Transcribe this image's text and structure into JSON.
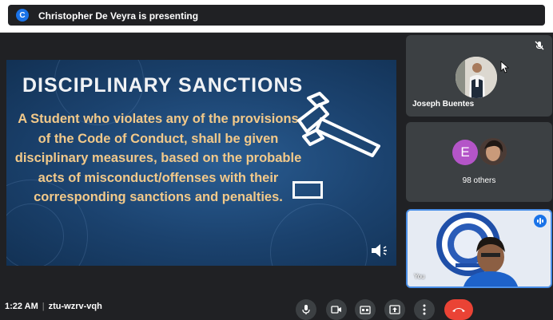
{
  "presenter": {
    "initial": "C",
    "banner": "Christopher De Veyra is presenting"
  },
  "slide": {
    "title": "DISCIPLINARY SANCTIONS",
    "body": "A Student who violates any of the provisions of the Code of Conduct, shall be given disciplinary measures, based on the probable acts of misconduct/offenses with their corresponding sanctions and penalties."
  },
  "participants": {
    "tile1": {
      "name": "Joseph Buentes",
      "muted": true
    },
    "tile2": {
      "avatar_initial": "E",
      "count_label": "98 others"
    },
    "tile3": {
      "label": "You",
      "speaking": true
    }
  },
  "bottombar": {
    "time": "1:22 AM",
    "meeting_code": "ztu-wzrv-vqh"
  },
  "icons": {
    "controls": [
      "mic-icon",
      "camera-icon",
      "captions-icon",
      "present-icon",
      "more-icon",
      "end-call-icon"
    ]
  },
  "colors": {
    "accent": "#1a73e8",
    "end_call": "#ea4335",
    "slide_text": "#f2c98a"
  }
}
